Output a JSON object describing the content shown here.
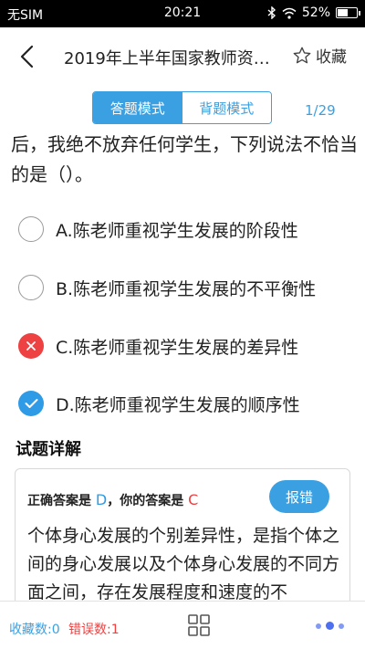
{
  "status_bar": {
    "carrier": "无SIM",
    "time": "20:21",
    "battery": "52%"
  },
  "header": {
    "title": "2019年上半年国家教师资…",
    "favorite_label": "收藏"
  },
  "mode_tabs": {
    "answer_mode": "答题模式",
    "memorize_mode": "背题模式"
  },
  "progress": "1/29",
  "question": {
    "text": "后，我绝不放弃任何学生，下列说法不恰当的是（）。"
  },
  "options": [
    {
      "label": "A.陈老师重视学生发展的阶段性",
      "state": "unselected"
    },
    {
      "label": "B.陈老师重视学生发展的不平衡性",
      "state": "unselected"
    },
    {
      "label": "C.陈老师重视学生发展的差异性",
      "state": "wrong"
    },
    {
      "label": "D.陈老师重视学生发展的顺序性",
      "state": "correct"
    }
  ],
  "detail": {
    "heading": "试题详解",
    "correct_answer_prefix": "正确答案是",
    "correct_answer": "D",
    "separator": "，",
    "your_answer_prefix": "你的答案是",
    "your_answer": "C",
    "report_button": "报错",
    "explanation": "个体身心发展的个别差异性，是指个体之间的身心发展以及个体身心发展的不同方面之间，存在发展程度和速度的不"
  },
  "bottom_bar": {
    "favorites_count": "收藏数:0",
    "errors_count": "错误数:1"
  },
  "colors": {
    "accent": "#3aa0e2",
    "correct": "#2f9be6",
    "wrong": "#ee4141",
    "page_dots": "#4d6ff0"
  }
}
